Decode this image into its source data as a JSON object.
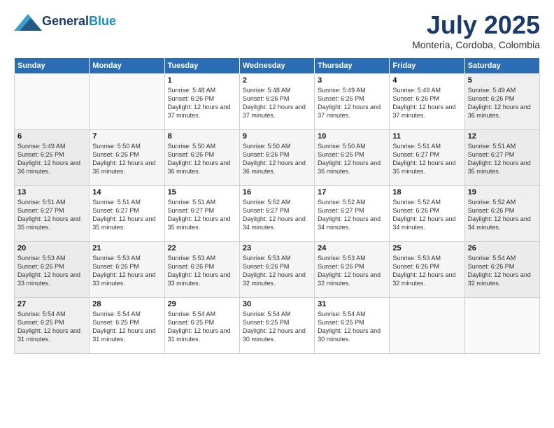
{
  "header": {
    "logo_line1": "General",
    "logo_line2": "Blue",
    "month": "July 2025",
    "location": "Monteria, Cordoba, Colombia"
  },
  "weekdays": [
    "Sunday",
    "Monday",
    "Tuesday",
    "Wednesday",
    "Thursday",
    "Friday",
    "Saturday"
  ],
  "weeks": [
    [
      {
        "day": "",
        "info": ""
      },
      {
        "day": "",
        "info": ""
      },
      {
        "day": "1",
        "info": "Sunrise: 5:48 AM\nSunset: 6:26 PM\nDaylight: 12 hours and 37 minutes."
      },
      {
        "day": "2",
        "info": "Sunrise: 5:48 AM\nSunset: 6:26 PM\nDaylight: 12 hours and 37 minutes."
      },
      {
        "day": "3",
        "info": "Sunrise: 5:49 AM\nSunset: 6:26 PM\nDaylight: 12 hours and 37 minutes."
      },
      {
        "day": "4",
        "info": "Sunrise: 5:49 AM\nSunset: 6:26 PM\nDaylight: 12 hours and 37 minutes."
      },
      {
        "day": "5",
        "info": "Sunrise: 5:49 AM\nSunset: 6:26 PM\nDaylight: 12 hours and 36 minutes."
      }
    ],
    [
      {
        "day": "6",
        "info": "Sunrise: 5:49 AM\nSunset: 6:26 PM\nDaylight: 12 hours and 36 minutes."
      },
      {
        "day": "7",
        "info": "Sunrise: 5:50 AM\nSunset: 6:26 PM\nDaylight: 12 hours and 36 minutes."
      },
      {
        "day": "8",
        "info": "Sunrise: 5:50 AM\nSunset: 6:26 PM\nDaylight: 12 hours and 36 minutes."
      },
      {
        "day": "9",
        "info": "Sunrise: 5:50 AM\nSunset: 6:26 PM\nDaylight: 12 hours and 36 minutes."
      },
      {
        "day": "10",
        "info": "Sunrise: 5:50 AM\nSunset: 6:26 PM\nDaylight: 12 hours and 36 minutes."
      },
      {
        "day": "11",
        "info": "Sunrise: 5:51 AM\nSunset: 6:27 PM\nDaylight: 12 hours and 35 minutes."
      },
      {
        "day": "12",
        "info": "Sunrise: 5:51 AM\nSunset: 6:27 PM\nDaylight: 12 hours and 35 minutes."
      }
    ],
    [
      {
        "day": "13",
        "info": "Sunrise: 5:51 AM\nSunset: 6:27 PM\nDaylight: 12 hours and 35 minutes."
      },
      {
        "day": "14",
        "info": "Sunrise: 5:51 AM\nSunset: 6:27 PM\nDaylight: 12 hours and 35 minutes."
      },
      {
        "day": "15",
        "info": "Sunrise: 5:51 AM\nSunset: 6:27 PM\nDaylight: 12 hours and 35 minutes."
      },
      {
        "day": "16",
        "info": "Sunrise: 5:52 AM\nSunset: 6:27 PM\nDaylight: 12 hours and 34 minutes."
      },
      {
        "day": "17",
        "info": "Sunrise: 5:52 AM\nSunset: 6:27 PM\nDaylight: 12 hours and 34 minutes."
      },
      {
        "day": "18",
        "info": "Sunrise: 5:52 AM\nSunset: 6:26 PM\nDaylight: 12 hours and 34 minutes."
      },
      {
        "day": "19",
        "info": "Sunrise: 5:52 AM\nSunset: 6:26 PM\nDaylight: 12 hours and 34 minutes."
      }
    ],
    [
      {
        "day": "20",
        "info": "Sunrise: 5:53 AM\nSunset: 6:26 PM\nDaylight: 12 hours and 33 minutes."
      },
      {
        "day": "21",
        "info": "Sunrise: 5:53 AM\nSunset: 6:26 PM\nDaylight: 12 hours and 33 minutes."
      },
      {
        "day": "22",
        "info": "Sunrise: 5:53 AM\nSunset: 6:26 PM\nDaylight: 12 hours and 33 minutes."
      },
      {
        "day": "23",
        "info": "Sunrise: 5:53 AM\nSunset: 6:26 PM\nDaylight: 12 hours and 32 minutes."
      },
      {
        "day": "24",
        "info": "Sunrise: 5:53 AM\nSunset: 6:26 PM\nDaylight: 12 hours and 32 minutes."
      },
      {
        "day": "25",
        "info": "Sunrise: 5:53 AM\nSunset: 6:26 PM\nDaylight: 12 hours and 32 minutes."
      },
      {
        "day": "26",
        "info": "Sunrise: 5:54 AM\nSunset: 6:26 PM\nDaylight: 12 hours and 32 minutes."
      }
    ],
    [
      {
        "day": "27",
        "info": "Sunrise: 5:54 AM\nSunset: 6:25 PM\nDaylight: 12 hours and 31 minutes."
      },
      {
        "day": "28",
        "info": "Sunrise: 5:54 AM\nSunset: 6:25 PM\nDaylight: 12 hours and 31 minutes."
      },
      {
        "day": "29",
        "info": "Sunrise: 5:54 AM\nSunset: 6:25 PM\nDaylight: 12 hours and 31 minutes."
      },
      {
        "day": "30",
        "info": "Sunrise: 5:54 AM\nSunset: 6:25 PM\nDaylight: 12 hours and 30 minutes."
      },
      {
        "day": "31",
        "info": "Sunrise: 5:54 AM\nSunset: 6:25 PM\nDaylight: 12 hours and 30 minutes."
      },
      {
        "day": "",
        "info": ""
      },
      {
        "day": "",
        "info": ""
      }
    ]
  ]
}
